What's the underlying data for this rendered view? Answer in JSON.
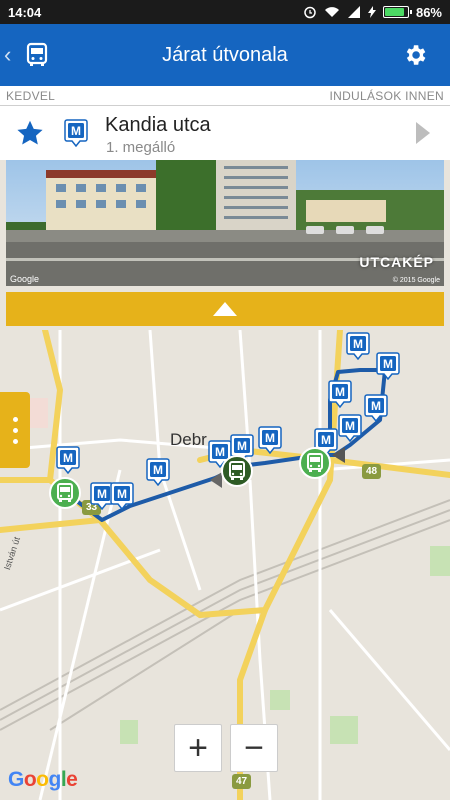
{
  "status": {
    "time": "14:04",
    "battery": "86%",
    "battery_level": 0.86
  },
  "appbar": {
    "title": "Járat útvonala",
    "back_icon": "chevron-left-icon",
    "bus_icon": "bus-icon",
    "settings_icon": "gear-icon"
  },
  "strip": {
    "left": "KEDVEL",
    "right": "INDULÁSOK INNEN"
  },
  "stop": {
    "name": "Kandia utca",
    "sub": "1. megálló"
  },
  "street": {
    "label": "UTCAKÉP",
    "google": "Google",
    "copyright": "© 2015 Google"
  },
  "map": {
    "city": "Debr",
    "side_street": "István út",
    "roads": [
      "33",
      "48",
      "47"
    ],
    "google": "Google",
    "zoom_in": "+",
    "zoom_out": "−"
  },
  "colors": {
    "primary": "#1565c0",
    "accent": "#e6b21a",
    "route": "#1e5ba8",
    "stop_green": "#4caf50"
  }
}
